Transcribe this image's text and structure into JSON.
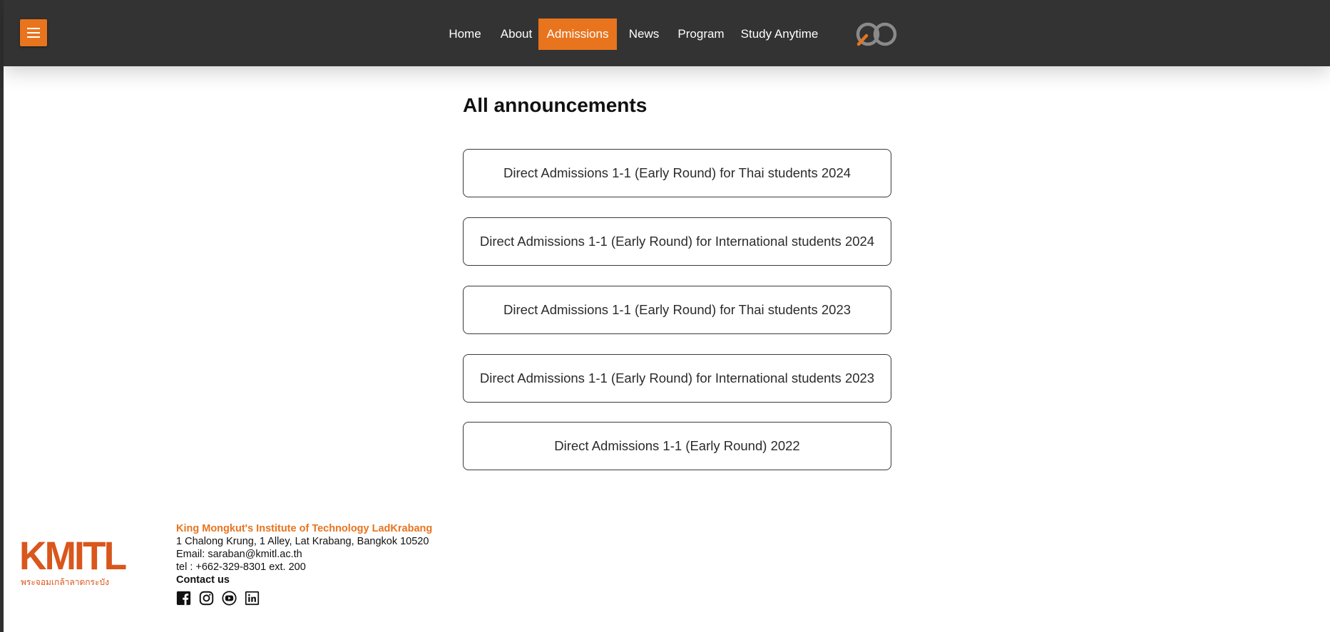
{
  "nav": {
    "menu_icon": "hamburger-menu-icon",
    "items": [
      {
        "label": "Home",
        "active": false
      },
      {
        "label": "About",
        "active": false
      },
      {
        "label": "Admissions",
        "active": true
      },
      {
        "label": "News",
        "active": false
      },
      {
        "label": "Program",
        "active": false
      },
      {
        "label": "Study Anytime",
        "active": false
      }
    ],
    "logo_icon": "infinity-logo-icon",
    "accent_color": "#e8741e",
    "bar_color": "#333333"
  },
  "main": {
    "title": "All announcements",
    "announcements": [
      {
        "label": "Direct Admissions 1-1 (Early Round) for Thai students 2024"
      },
      {
        "label": "Direct Admissions 1-1 (Early Round) for International students 2024"
      },
      {
        "label": "Direct Admissions 1-1 (Early Round) for Thai students 2023"
      },
      {
        "label": "Direct Admissions 1-1 (Early Round) for International students 2023"
      },
      {
        "label": "Direct Admissions 1-1 (Early Round) 2022"
      }
    ]
  },
  "footer": {
    "logo_text": "KMITL",
    "logo_subtext": "พระจอมเกล้าลาดกระบัง",
    "org_name": "King Mongkut's Institute of Technology LadKrabang",
    "address": "1 Chalong Krung, 1 Alley, Lat Krabang, Bangkok 10520",
    "email": "Email: saraban@kmitl.ac.th",
    "tel": "tel : +662-329-8301 ext. 200",
    "contact_title": "Contact us",
    "socials": [
      "facebook-icon",
      "instagram-icon",
      "youtube-icon",
      "linkedin-icon"
    ]
  }
}
